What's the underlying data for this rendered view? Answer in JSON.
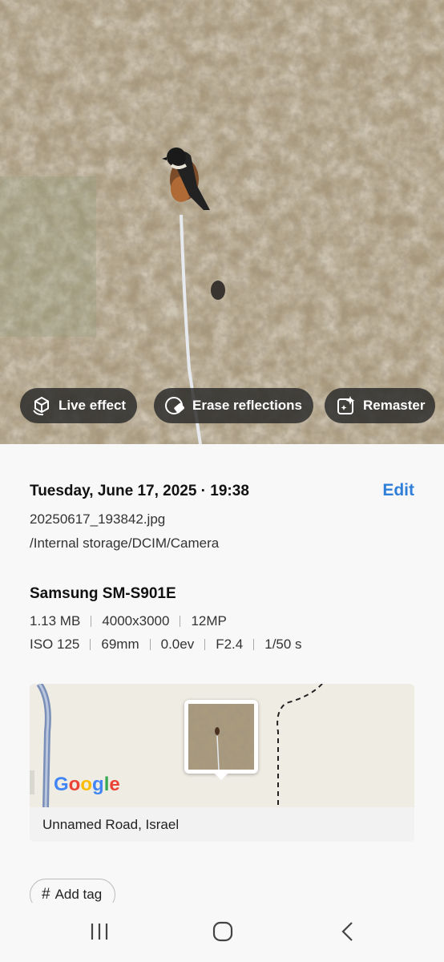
{
  "photo": {
    "actions": [
      {
        "label": "Live effect",
        "icon": "live-effect-icon"
      },
      {
        "label": "Erase reflections",
        "icon": "erase-reflections-icon"
      },
      {
        "label": "Remaster",
        "icon": "remaster-icon"
      }
    ]
  },
  "details": {
    "datetime": "Tuesday, June 17, 2025 · 19:38",
    "edit_label": "Edit",
    "filename": "20250617_193842.jpg",
    "path": "/Internal storage/DCIM/Camera",
    "camera_model": "Samsung SM-S901E",
    "specs_row1": [
      "1.13 MB",
      "4000x3000",
      "12MP"
    ],
    "specs_row2": [
      "ISO 125",
      "69mm",
      "0.0ev",
      "F2.4",
      "1/50 s"
    ]
  },
  "map": {
    "provider": "Google",
    "address": "Unnamed Road, Israel"
  },
  "tags": {
    "add_tag_label": "Add tag"
  },
  "navbar": {
    "icons": [
      "recents-icon",
      "home-icon",
      "back-icon"
    ]
  },
  "colors": {
    "accent": "#2f7ed8",
    "chip_bg": "#282828"
  }
}
